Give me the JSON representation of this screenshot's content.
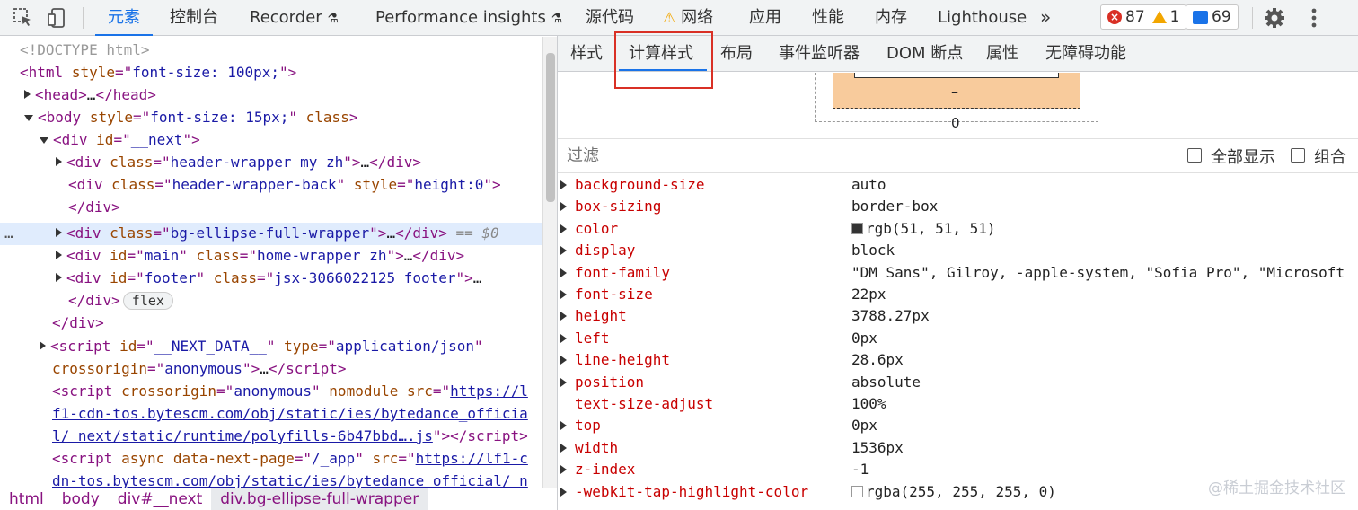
{
  "toolbar": {
    "tabs": [
      "元素",
      "控制台",
      "Recorder",
      "Performance insights",
      "源代码",
      "网络",
      "应用",
      "性能",
      "内存",
      "Lighthouse"
    ],
    "more": "»",
    "errors": "87",
    "warnings": "1",
    "messages": "69"
  },
  "dom": {
    "lines": [
      {
        "html": "<span class='t-gray'>&lt;!DOCTYPE html&gt;</span>"
      },
      {
        "html": "<span class='t-tag'>&lt;html</span> <span class='t-attr'>style</span><span class='t-tag'>=\"</span><span class='t-val'>font-size: 100px;</span><span class='t-tag'>\"&gt;</span>"
      },
      {
        "html": "<span class='t-tag'>&lt;head&gt;</span>…<span class='t-tag'>&lt;/head&gt;</span>"
      },
      {
        "html": "<span class='t-tag'>&lt;body</span> <span class='t-attr'>style</span><span class='t-tag'>=\"</span><span class='t-val'>font-size: 15px;</span><span class='t-tag'>\"</span> <span class='t-attr'>class</span><span class='t-tag'>&gt;</span>"
      },
      {
        "html": "<span class='t-tag'>&lt;div</span> <span class='t-attr'>id</span><span class='t-tag'>=\"</span><span class='t-val'>__next</span><span class='t-tag'>\"&gt;</span>"
      },
      {
        "html": "<span class='t-tag'>&lt;div</span> <span class='t-attr'>class</span><span class='t-tag'>=\"</span><span class='t-val'>header-wrapper my zh</span><span class='t-tag'>\"&gt;</span>…<span class='t-tag'>&lt;/div&gt;</span>"
      },
      {
        "html": "<span class='t-tag'>&lt;div</span> <span class='t-attr'>class</span><span class='t-tag'>=\"</span><span class='t-val'>header-wrapper-back</span><span class='t-tag'>\"</span> <span class='t-attr'>style</span><span class='t-tag'>=\"</span><span class='t-val'>height:0</span><span class='t-tag'>\"&gt;</span>"
      },
      {
        "html": "<span class='t-tag'>&lt;/div&gt;</span>"
      },
      {
        "html": "<span class='t-tag'>&lt;div</span> <span class='t-attr'>class</span><span class='t-tag'>=\"</span><span class='t-val'>bg-ellipse-full-wrapper</span><span class='t-tag'>\"&gt;</span>…<span class='t-tag'>&lt;/div&gt;</span> <span class='t-eq'>== $0</span>"
      },
      {
        "html": "<span class='t-tag'>&lt;div</span> <span class='t-attr'>id</span><span class='t-tag'>=\"</span><span class='t-val'>main</span><span class='t-tag'>\"</span> <span class='t-attr'>class</span><span class='t-tag'>=\"</span><span class='t-val'>home-wrapper zh</span><span class='t-tag'>\"&gt;</span>…<span class='t-tag'>&lt;/div&gt;</span>"
      },
      {
        "html": "<span class='t-tag'>&lt;div</span> <span class='t-attr'>id</span><span class='t-tag'>=\"</span><span class='t-val'>footer</span><span class='t-tag'>\"</span> <span class='t-attr'>class</span><span class='t-tag'>=\"</span><span class='t-val'>jsx-3066022125 footer</span><span class='t-tag'>\"&gt;</span>…"
      },
      {
        "html": "<span class='t-tag'>&lt;/div&gt;</span>"
      },
      {
        "html": "<span class='t-tag'>&lt;/div&gt;</span>"
      },
      {
        "html": "<span class='t-tag'>&lt;script</span> <span class='t-attr'>id</span><span class='t-tag'>=\"</span><span class='t-val'>__NEXT_DATA__</span><span class='t-tag'>\"</span> <span class='t-attr'>type</span><span class='t-tag'>=\"</span><span class='t-val'>application/json</span><span class='t-tag'>\"</span>"
      },
      {
        "html": "<span class='t-attr'>crossorigin</span><span class='t-tag'>=\"</span><span class='t-val'>anonymous</span><span class='t-tag'>\"&gt;</span>…<span class='t-tag'>&lt;/script&gt;</span>"
      },
      {
        "html": "<span class='t-tag'>&lt;script</span> <span class='t-attr'>crossorigin</span><span class='t-tag'>=\"</span><span class='t-val'>anonymous</span><span class='t-tag'>\"</span> <span class='t-attr'>nomodule</span> <span class='t-attr'>src</span><span class='t-tag'>=\"</span><span class='t-link'>https://l</span>"
      },
      {
        "html": "<span class='t-link'>f1-cdn-tos.bytescm.com/obj/static/ies/bytedance_officia</span>"
      },
      {
        "html": "<span class='t-link'>l/_next/static/runtime/polyfills-6b47bbd….js</span><span class='t-tag'>\"&gt;&lt;/script&gt;</span>"
      },
      {
        "html": "<span class='t-tag'>&lt;script</span> <span class='t-attr'>async</span> <span class='t-attr'>data-next-page</span><span class='t-tag'>=\"</span><span class='t-val'>/_app</span><span class='t-tag'>\"</span> <span class='t-attr'>src</span><span class='t-tag'>=\"</span><span class='t-link'>https://lf1-c</span>"
      },
      {
        "html": "<span class='t-link'>dn-tos.bytescm.com/obj/static/ies/bytedance_official/_n</span>"
      }
    ],
    "flex_badge": "flex",
    "selected_marker": "…"
  },
  "breadcrumb": [
    "html",
    "body",
    "div#__next",
    "div.bg-ellipse-full-wrapper"
  ],
  "right_tabs": [
    "样式",
    "计算样式",
    "布局",
    "事件监听器",
    "DOM 断点",
    "属性",
    "无障碍功能"
  ],
  "box_model": {
    "content": "–",
    "margin_bottom": "0"
  },
  "filter": {
    "placeholder": "过滤",
    "show_all": "全部显示",
    "group": "组合"
  },
  "computed": [
    {
      "name": "background-size",
      "value": "auto",
      "expandable": true
    },
    {
      "name": "box-sizing",
      "value": "border-box",
      "expandable": true
    },
    {
      "name": "color",
      "value": "rgb(51, 51, 51)",
      "expandable": true,
      "swatch": "#333333"
    },
    {
      "name": "display",
      "value": "block",
      "expandable": true
    },
    {
      "name": "font-family",
      "value": "\"DM Sans\", Gilroy, -apple-system, \"Sofia Pro\", \"Microsoft",
      "expandable": true
    },
    {
      "name": "font-size",
      "value": "22px",
      "expandable": true
    },
    {
      "name": "height",
      "value": "3788.27px",
      "expandable": true
    },
    {
      "name": "left",
      "value": "0px",
      "expandable": true
    },
    {
      "name": "line-height",
      "value": "28.6px",
      "expandable": true
    },
    {
      "name": "position",
      "value": "absolute",
      "expandable": true
    },
    {
      "name": "text-size-adjust",
      "value": "100%",
      "expandable": false
    },
    {
      "name": "top",
      "value": "0px",
      "expandable": true
    },
    {
      "name": "width",
      "value": "1536px",
      "expandable": true
    },
    {
      "name": "z-index",
      "value": "-1",
      "expandable": true
    },
    {
      "name": "-webkit-tap-highlight-color",
      "value": "rgba(255, 255, 255, 0)",
      "expandable": true,
      "swatch": "#ffffff"
    }
  ],
  "watermark": "@稀土掘金技术社区",
  "colors": {
    "accent": "#1a73e8",
    "highlight": "#d93025",
    "tag": "#881280",
    "attr": "#994500",
    "value": "#1a1aa6",
    "prop": "#c80000"
  }
}
